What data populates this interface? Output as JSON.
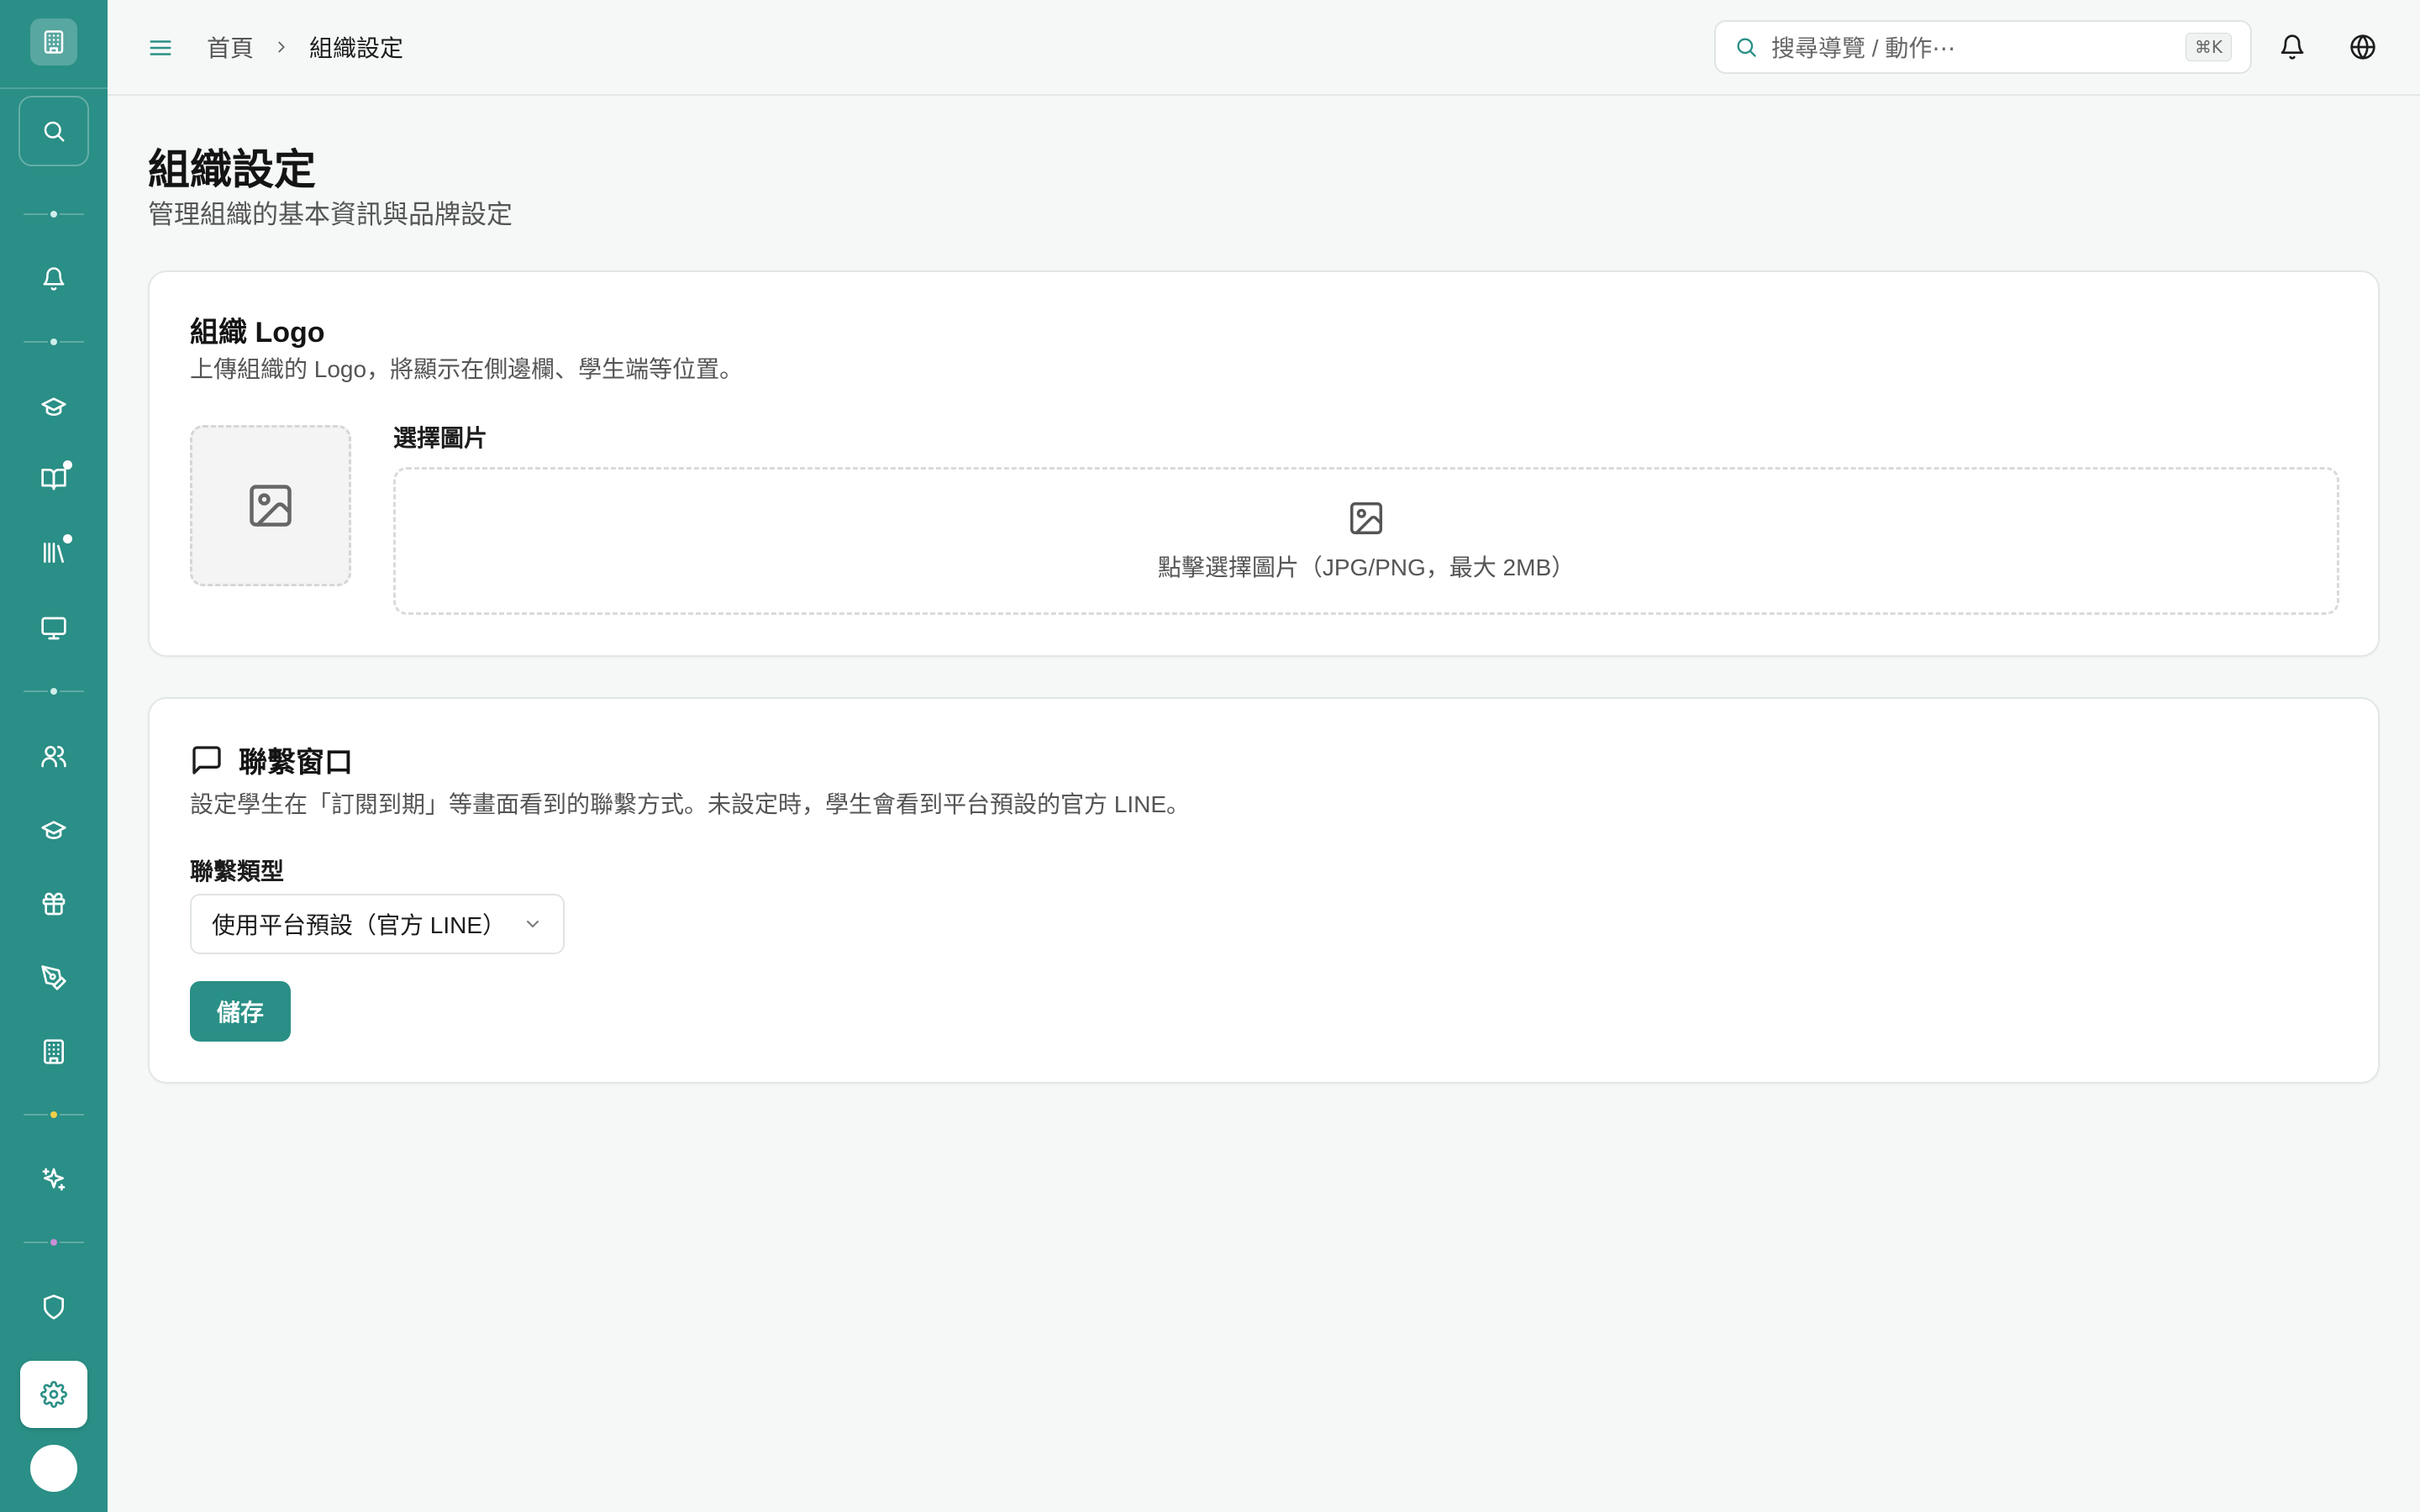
{
  "header": {
    "breadcrumb": {
      "home": "首頁",
      "current": "組織設定"
    },
    "search": {
      "placeholder": "搜尋導覽 / 動作⋯",
      "shortcut": "⌘K"
    }
  },
  "page": {
    "title": "組織設定",
    "subtitle": "管理組織的基本資訊與品牌設定"
  },
  "logo_card": {
    "title": "組織 Logo",
    "description": "上傳組織的 Logo，將顯示在側邊欄、學生端等位置。",
    "picker_label": "選擇圖片",
    "dropzone_text": "點擊選擇圖片（JPG/PNG，最大 2MB）"
  },
  "contact_card": {
    "title": "聯繫窗口",
    "description": "設定學生在「訂閱到期」等畫面看到的聯繫方式。未設定時，學生會看到平台預設的官方 LINE。",
    "type_label": "聯繫類型",
    "type_value": "使用平台預設（官方 LINE）",
    "save_label": "儲存"
  },
  "sidebar": {
    "items": [
      {
        "icon": "bell-icon"
      },
      {
        "icon": "graduation-cap-icon"
      },
      {
        "icon": "book-open-icon",
        "badge": true
      },
      {
        "icon": "library-icon",
        "badge": true
      },
      {
        "icon": "monitor-icon"
      },
      {
        "icon": "users-icon"
      },
      {
        "icon": "graduation-cap-icon"
      },
      {
        "icon": "gift-icon"
      },
      {
        "icon": "pen-tool-icon"
      },
      {
        "icon": "building-icon"
      },
      {
        "icon": "sparkles-icon"
      },
      {
        "icon": "shield-icon"
      },
      {
        "icon": "settings-icon",
        "active": true
      }
    ],
    "separator_colors": [
      "#cfeee9",
      "#cfeee9",
      "#cfeee9",
      "#f2cf4a",
      "#c98fd6"
    ]
  },
  "colors": {
    "brand": "#2a8f86",
    "background": "#f5f8f7"
  }
}
